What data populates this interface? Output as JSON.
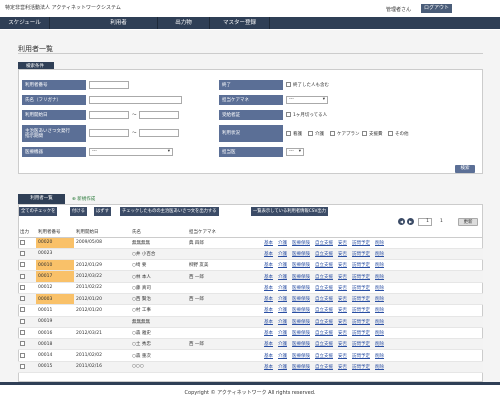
{
  "header": {
    "org": "特定非営利活動法人 アクティネットワークシステム",
    "admin": "管理者さん",
    "logout": "ログアウト"
  },
  "nav": [
    "スケジュール",
    "利用者",
    "出力物",
    "マスター登録"
  ],
  "page_title": "利用者一覧",
  "search": {
    "title": "検索条件",
    "labels": {
      "user_no": "利用者番号",
      "name_kana": "氏名（フリガナ）",
      "start_date": "利用開始日",
      "greeting": "主治医あいさつ文発行\n指示期間",
      "device": "医療機器",
      "end": "終了",
      "manager": "担当ケアマネ",
      "cert": "受給者証",
      "status": "利用状況",
      "doctor": "担当医"
    },
    "include_ended": "終了した人も含む",
    "cert_expire": "1ヶ月切ってる人",
    "status_opts": [
      "看護",
      "介護",
      "ケアプラン",
      "支援費",
      "その他"
    ],
    "select_empty": "---",
    "tilde": "～",
    "search_btn": "検索"
  },
  "list": {
    "tab": "利用者一覧",
    "new": "新規作成",
    "toolbar": [
      "全てのチェックを",
      "付ける",
      "はずす",
      "チェックしたものの主治医あいさつ文を出力する",
      "一覧表示している利用者情報CSV出力"
    ],
    "page": "1",
    "page_total": "1",
    "headers": [
      "出力",
      "利用者番号",
      "利用開始日",
      "氏名",
      "担当ケアマネ"
    ],
    "actions": [
      "基本",
      "介護",
      "医療保険",
      "自立支援",
      "安否",
      "訪問予定",
      "削除"
    ],
    "rows": [
      {
        "no": "00020",
        "date": "2009/05/08",
        "name": "無無無無",
        "cm": "典 四郎",
        "hi": true
      },
      {
        "no": "00023",
        "date": "",
        "name": "○井 小百合",
        "cm": "",
        "hi": false
      },
      {
        "no": "00010",
        "date": "2012/01/29",
        "name": "○崎 要",
        "cm": "柳野 友美",
        "hi": true
      },
      {
        "no": "00017",
        "date": "2012/03/22",
        "name": "○林 本人",
        "cm": "西 一郎",
        "hi": true
      },
      {
        "no": "00012",
        "date": "2011/02/22",
        "name": "○藤 真司",
        "cm": "",
        "hi": false
      },
      {
        "no": "00003",
        "date": "2012/01/20",
        "name": "○西 賢治",
        "cm": "西 一郎",
        "hi": true
      },
      {
        "no": "00011",
        "date": "2012/01/20",
        "name": "○村 工事",
        "cm": "",
        "hi": false
      },
      {
        "no": "00019",
        "date": "",
        "name": "無無無無",
        "cm": "",
        "hi": false
      },
      {
        "no": "00016",
        "date": "2012/03/21",
        "name": "○森 雅史",
        "cm": "",
        "hi": false
      },
      {
        "no": "00018",
        "date": "",
        "name": "○土 秀忠",
        "cm": "西 一郎",
        "hi": false
      },
      {
        "no": "00014",
        "date": "2011/02/02",
        "name": "○森 重次",
        "cm": "",
        "hi": false
      },
      {
        "no": "00015",
        "date": "2011/02/16",
        "name": "○○○",
        "cm": "",
        "hi": false
      }
    ]
  },
  "update": "更新",
  "footer": "Copyright © アクティネットワーク All rights reserved."
}
